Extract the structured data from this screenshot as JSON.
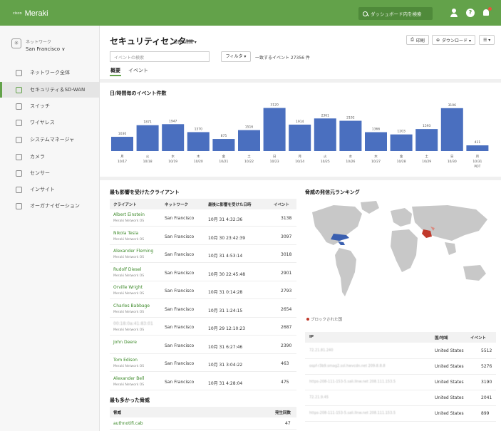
{
  "app": {
    "brand_small": "cisco",
    "brand": "Meraki",
    "search_placeholder": "ダッシュボード内を検索",
    "help_label": "?"
  },
  "sidebar": {
    "network_label": "ネットワーク",
    "network_value": "San Francisco ∨",
    "items": [
      {
        "label": "ネットワーク全体",
        "icon": "globe-icon",
        "active": false
      },
      {
        "label": "セキュリティ＆SD-WAN",
        "icon": "shield-icon",
        "active": true
      },
      {
        "label": "スイッチ",
        "icon": "switch-icon",
        "active": false
      },
      {
        "label": "ワイヤレス",
        "icon": "wifi-icon",
        "active": false
      },
      {
        "label": "システムマネージャ",
        "icon": "system-manager-icon",
        "active": false
      },
      {
        "label": "カメラ",
        "icon": "camera-icon",
        "active": false
      },
      {
        "label": "センサー",
        "icon": "sensor-icon",
        "active": false
      },
      {
        "label": "インサイト",
        "icon": "insight-icon",
        "active": false
      },
      {
        "label": "オーガナイゼーション",
        "icon": "organization-icon",
        "active": false
      }
    ]
  },
  "header": {
    "title": "セキュリティセンター",
    "range": "過去7週間 ▾",
    "print": "印刷",
    "download": "ダウンロード ▾",
    "view": "☰ ▾"
  },
  "filters": {
    "event_search_placeholder": "イベントの検索",
    "filter_button": "フィルタ ▾",
    "match_count": "一致するイベント 27356 件"
  },
  "tabs": [
    "概要",
    "イベント"
  ],
  "chart_title": "日/時間毎のイベント件数",
  "chart_data": {
    "type": "bar",
    "categories": [
      "10/17",
      "10/18",
      "10/19",
      "10/20",
      "10/21",
      "10/22",
      "10/23",
      "10/24",
      "10/25",
      "10/26",
      "10/27",
      "10/28",
      "10/29",
      "10/30",
      "10/31"
    ],
    "weekdays": [
      "月",
      "火",
      "水",
      "木",
      "金",
      "土",
      "日",
      "月",
      "火",
      "水",
      "木",
      "金",
      "土",
      "日",
      "月"
    ],
    "last_suffix": "PDT",
    "values": [
      1030,
      1871,
      1947,
      1370,
      875,
      1516,
      3120,
      1914,
      2361,
      2192,
      1366,
      1203,
      1593,
      3106,
      411
    ],
    "bar_color": "#4a6fbf",
    "ylim": [
      0,
      3200
    ]
  },
  "clients": {
    "title": "最も影響を受けたクライアント",
    "headers": [
      "クライアント",
      "ネットワーク",
      "最後に影響を受けた日時",
      "イベント"
    ],
    "rows": [
      {
        "name": "Albert Einstein",
        "os": "Meraki Network OS",
        "network": "San Francisco",
        "time": "10月 31 4:32:36",
        "events": "3138"
      },
      {
        "name": "Nikola Tesla",
        "os": "Meraki Network OS",
        "network": "San Francisco",
        "time": "10月 30 23:42:39",
        "events": "3097"
      },
      {
        "name": "Alexander Fleming",
        "os": "Meraki Network OS",
        "network": "San Francisco",
        "time": "10月 31 4:53:14",
        "events": "3018"
      },
      {
        "name": "Rudolf Diesel",
        "os": "Meraki Network OS",
        "network": "San Francisco",
        "time": "10月 30 22:45:48",
        "events": "2901"
      },
      {
        "name": "Orville Wright",
        "os": "Meraki Network OS",
        "network": "San Francisco",
        "time": "10月 31 0:14:28",
        "events": "2793"
      },
      {
        "name": "Charles Babbage",
        "os": "Meraki Network OS",
        "network": "San Francisco",
        "time": "10月 31 1:24:15",
        "events": "2654"
      },
      {
        "name": "00:18:0a:41:83:01",
        "os": "Meraki Network OS",
        "network": "San Francisco",
        "time": "10月 29 12:10:23",
        "events": "2687"
      },
      {
        "name": "John Deere",
        "os": "",
        "network": "San Francisco",
        "time": "10月 31 6:27:46",
        "events": "2390"
      },
      {
        "name": "Tom Edison",
        "os": "Meraki Network OS",
        "network": "San Francisco",
        "time": "10月 31 3:04:22",
        "events": "463"
      },
      {
        "name": "Alexander Bell",
        "os": "Meraki Network OS",
        "network": "San Francisco",
        "time": "10月 31 4:28:04",
        "events": "475"
      }
    ]
  },
  "threats": {
    "title": "最も多かった脅威",
    "headers": [
      "脅威",
      "発生回数"
    ],
    "rows": [
      {
        "name": "authnotifi.cab",
        "count": "47"
      }
    ]
  },
  "ranking": {
    "title": "脅威の発信元ランキング",
    "legend": "ブロックされた国",
    "headers": [
      "IP",
      "国/地域",
      "イベント"
    ],
    "rows": [
      {
        "ip": "72.21.81.240",
        "country": "United States",
        "events": "5512"
      },
      {
        "ip": "ospf-r3b9.smag2.ssl.hwvcdn.net 209.8.8.8",
        "country": "United States",
        "events": "5276"
      },
      {
        "ip": "https-208-111-153-5.sali.llnw.net 208.111.153.5",
        "country": "United States",
        "events": "3190"
      },
      {
        "ip": "72.21.9.45",
        "country": "United States",
        "events": "2041"
      },
      {
        "ip": "https-208-111-153-5.sali.llnw.net 208.111.153.5",
        "country": "United States",
        "events": "899"
      }
    ]
  }
}
